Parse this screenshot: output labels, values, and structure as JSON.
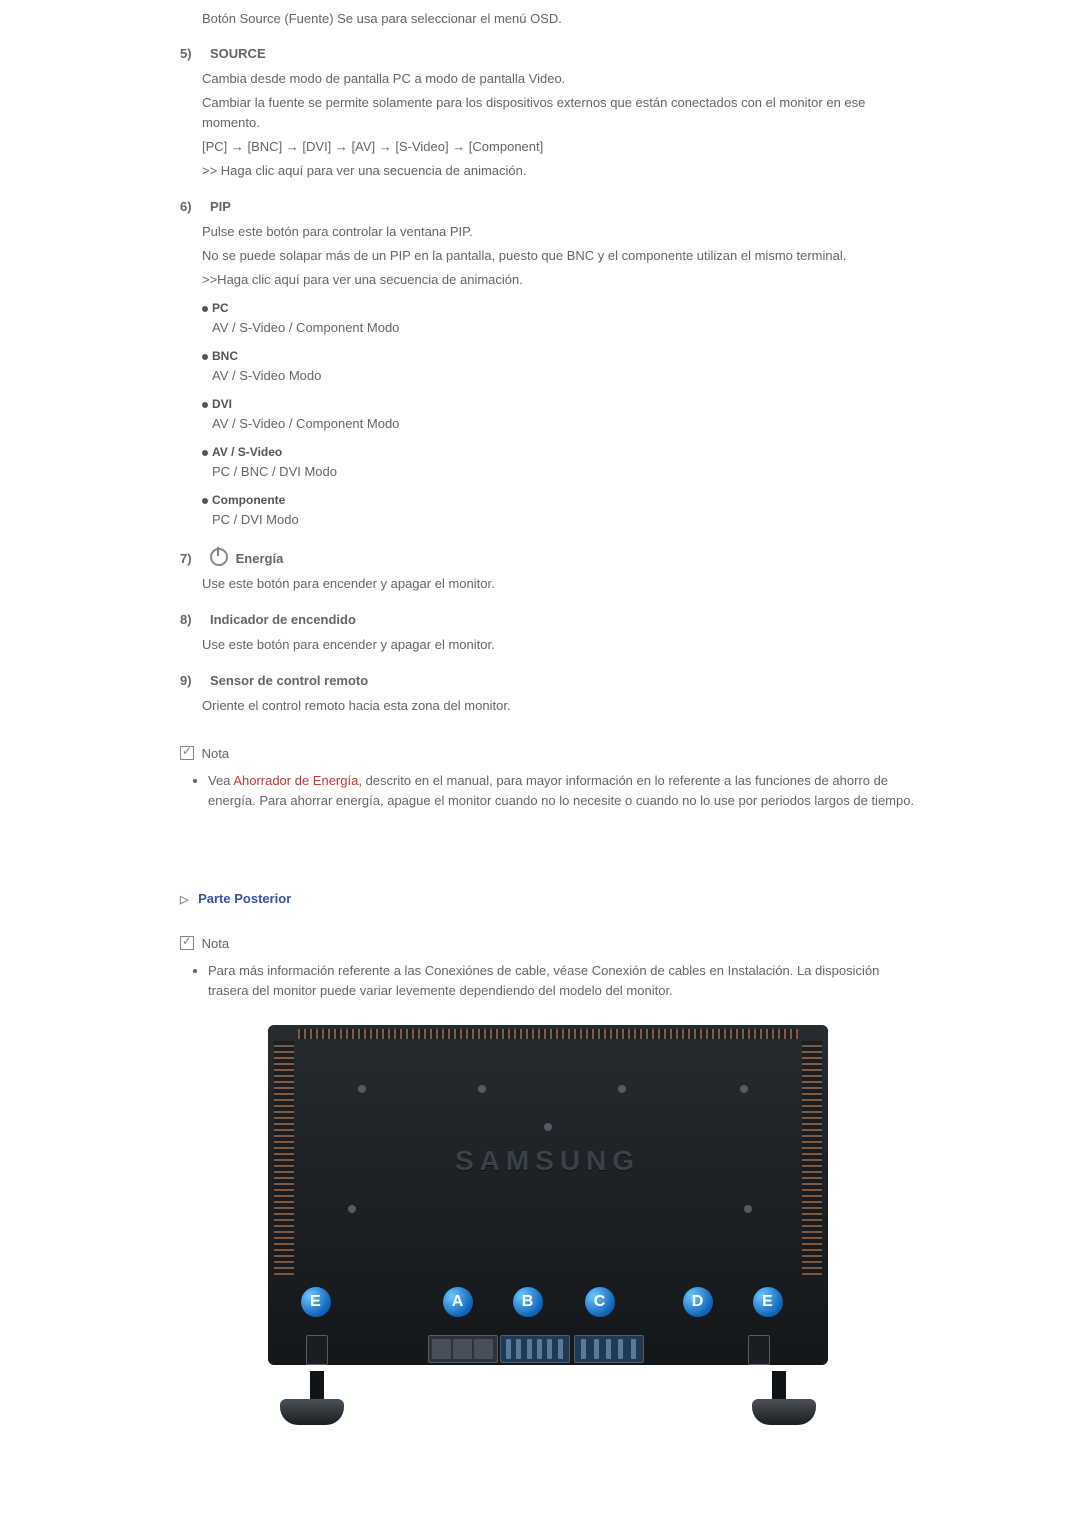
{
  "intro_text": "Botón Source (Fuente) Se usa para seleccionar el menú OSD.",
  "sections": {
    "s5": {
      "num": "5)",
      "title": "SOURCE",
      "p1": "Cambia desde modo de pantalla PC a modo de pantalla Video.",
      "p2": "Cambiar la fuente se permite solamente para los dispositivos externos que están conectados con el monitor en ese momento.",
      "p3": "[PC] → [BNC] → [DVI] → [AV] → [S-Video] → [Component]",
      "p4": ">> Haga clic aquí para ver una secuencia de animación."
    },
    "s6": {
      "num": "6)",
      "title": "PIP",
      "p1": "Pulse este botón para controlar la ventana PIP.",
      "p2": "No se puede solapar más de un PIP en la pantalla, puesto que BNC y el componente utilizan el mismo terminal.",
      "p3": ">>Haga clic aquí para ver una secuencia de animación.",
      "items": [
        {
          "name": "PC",
          "text": "AV / S-Video / Component Modo"
        },
        {
          "name": "BNC",
          "text": "AV / S-Video Modo"
        },
        {
          "name": "DVI",
          "text": "AV / S-Video / Component Modo"
        },
        {
          "name": "AV / S-Video",
          "text": "PC / BNC / DVI Modo"
        },
        {
          "name": "Componente",
          "text": "PC / DVI Modo"
        }
      ]
    },
    "s7": {
      "num": "7)",
      "title": "Energía",
      "p1": "Use este botón para encender y apagar el monitor."
    },
    "s8": {
      "num": "8)",
      "title": "Indicador de encendido",
      "p1": "Use este botón para encender y apagar el monitor."
    },
    "s9": {
      "num": "9)",
      "title": "Sensor de control remoto",
      "p1": "Oriente el control remoto hacia esta zona del monitor."
    }
  },
  "note1": {
    "label": "Nota",
    "text_a": "Vea ",
    "text_link": "Ahorrador de Energía,",
    "text_b": " descrito en el manual, para mayor información en lo referente a las funciones de ahorro de energía. Para ahorrar energía, apague el monitor cuando no lo necesite o cuando no lo use por periodos largos de tiempo."
  },
  "back_heading": "Parte Posterior",
  "note2": {
    "label": "Nota",
    "text": "Para más información referente a las Conexiónes de cable, véase Conexión de cables en Instalación. La disposición trasera del monitor puede variar levemente dependiendo del modelo del monitor."
  },
  "monitor": {
    "brand": "SAMSUNG",
    "labels": {
      "a": "A",
      "b": "B",
      "c": "C",
      "d": "D",
      "eL": "E",
      "eR": "E"
    }
  }
}
